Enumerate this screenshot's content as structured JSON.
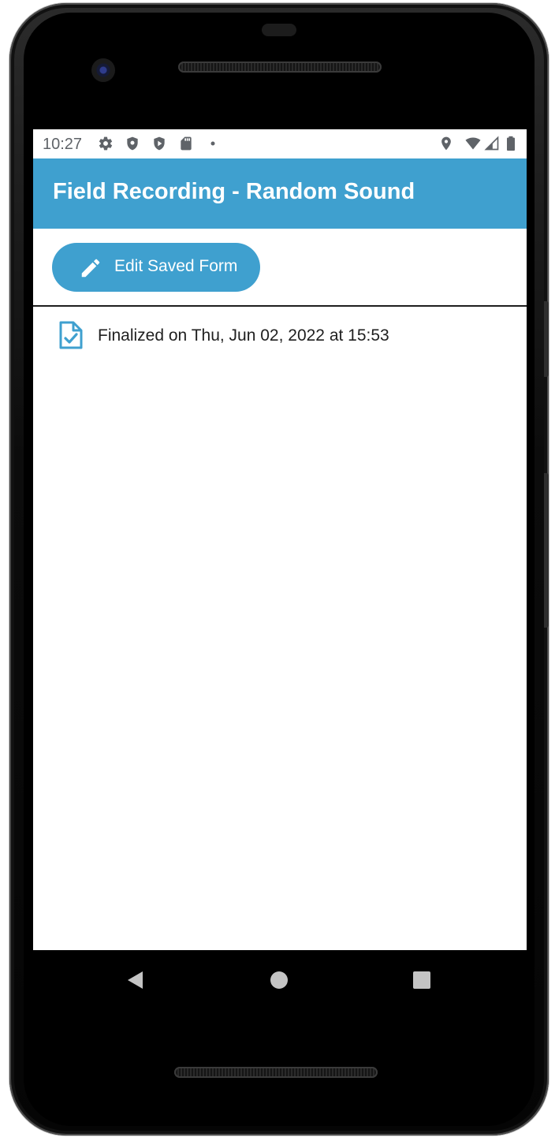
{
  "status_bar": {
    "time": "10:27",
    "left_icons": [
      "settings-icon",
      "shield-icon",
      "play-shield-icon",
      "sd-card-icon",
      "notification-dot-icon"
    ],
    "right_icons": [
      "location-icon",
      "wifi-icon",
      "signal-icon",
      "battery-icon"
    ]
  },
  "app_bar": {
    "title": "Field Recording - Random Sound",
    "color": "#3fa0cf"
  },
  "actions": {
    "edit_button_label": "Edit Saved Form",
    "edit_button_icon": "pencil-icon"
  },
  "form_status": {
    "icon": "document-check-icon",
    "text": "Finalized on Thu, Jun 02, 2022 at 15:53"
  },
  "nav_bar": {
    "buttons": [
      "back-icon",
      "home-icon",
      "recents-icon"
    ]
  }
}
